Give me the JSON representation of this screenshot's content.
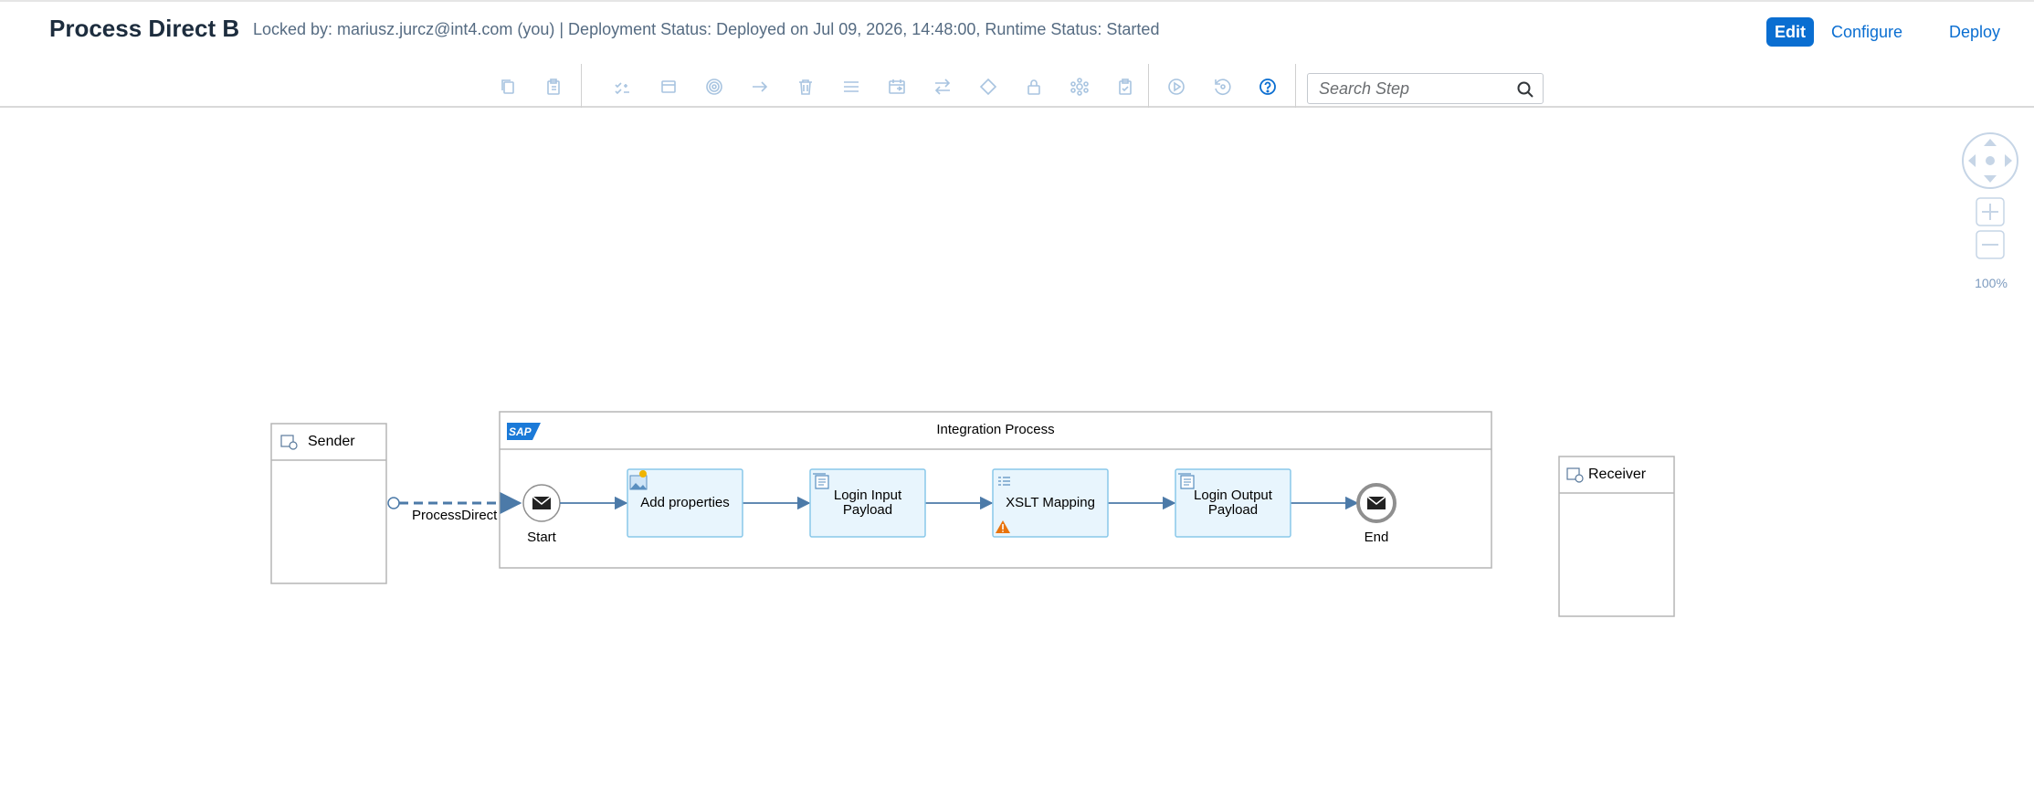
{
  "header": {
    "title": "Process Direct B",
    "status": "Locked by: mariusz.jurcz@int4.com (you) | Deployment Status: Deployed on Jul 09, 2026, 14:48:00, Runtime Status: Started",
    "actions": {
      "edit": "Edit",
      "configure": "Configure",
      "deploy": "Deploy"
    }
  },
  "toolbar": {
    "icons": [
      "copy-icon",
      "paste-icon",
      "participants-icon",
      "process-icon",
      "events-icon",
      "connector-icon",
      "delete-icon",
      "list-icon",
      "schedule-icon",
      "transform-icon",
      "gateway-icon",
      "security-icon",
      "integration-icon",
      "validate-icon",
      "simulate-icon",
      "reset-icon",
      "help-icon"
    ],
    "search": {
      "placeholder": "Search Step",
      "value": ""
    }
  },
  "navigation": {
    "zoom": "100%"
  },
  "diagram": {
    "sender": "Sender",
    "receiver": "Receiver",
    "process_title": "Integration Process",
    "sap_logo": "SAP",
    "connection_label": "ProcessDirect",
    "start_label": "Start",
    "end_label": "End",
    "steps": [
      {
        "label": "Add properties",
        "icon": "content-modifier-icon"
      },
      {
        "label": "Login Input Payload",
        "icon": "script-icon"
      },
      {
        "label": "XSLT Mapping",
        "icon": "mapping-icon",
        "warning": true
      },
      {
        "label": "Login Output Payload",
        "icon": "script-icon"
      }
    ]
  },
  "colors": {
    "accent": "#0a6ed1",
    "step_fill": "#e8f5fd",
    "step_border": "#89c8ea",
    "flow_line": "#4c7aa8",
    "warning": "#e9730c"
  }
}
